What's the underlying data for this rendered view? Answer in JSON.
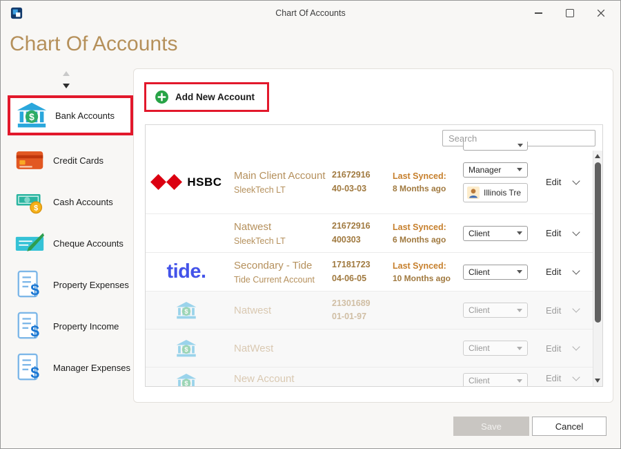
{
  "titlebar": {
    "title": "Chart Of Accounts"
  },
  "page": {
    "heading": "Chart Of Accounts"
  },
  "sidebar": {
    "items": [
      {
        "label": "Bank Accounts"
      },
      {
        "label": "Credit Cards"
      },
      {
        "label": "Cash Accounts"
      },
      {
        "label": "Cheque Accounts"
      },
      {
        "label": "Property Expenses"
      },
      {
        "label": "Property Income"
      },
      {
        "label": "Manager Expenses"
      }
    ]
  },
  "toolbar": {
    "add_account_label": "Add New Account"
  },
  "search": {
    "placeholder": "Search"
  },
  "table": {
    "rows": [
      {
        "brand": "HSBC",
        "name": "Main Client Account",
        "subtitle": "SleekTech LT",
        "account_number": "21672916",
        "sort_code": "40-03-03",
        "last_synced_label": "Last Synced:",
        "last_synced": "8 Months ago",
        "role": "Manager",
        "assignee": "Illinois Tre",
        "edit_label": "Edit"
      },
      {
        "name": "Natwest",
        "subtitle": "SleekTech LT",
        "account_number": "21672916",
        "sort_code": "400303",
        "last_synced_label": "Last Synced:",
        "last_synced": "6 Months ago",
        "role": "Client",
        "edit_label": "Edit"
      },
      {
        "brand": "tide.",
        "name": "Secondary - Tide",
        "subtitle": "Tide Current Account",
        "account_number": "17181723",
        "sort_code": "04-06-05",
        "last_synced_label": "Last Synced:",
        "last_synced": "10 Months ago",
        "role": "Client",
        "edit_label": "Edit"
      },
      {
        "name": "Natwest",
        "account_number": "21301689",
        "sort_code": "01-01-97",
        "role": "Client",
        "edit_label": "Edit",
        "disabled": true
      },
      {
        "name": "NatWest",
        "role": "Client",
        "edit_label": "Edit",
        "disabled": true
      },
      {
        "name": "New Account",
        "role": "Client",
        "edit_label": "Edit",
        "disabled": true
      }
    ]
  },
  "footer": {
    "save_label": "Save",
    "cancel_label": "Cancel"
  },
  "colors": {
    "heading_gold": "#b5905a",
    "annotation_red": "#e2182b",
    "hsbc_red": "#db0011",
    "tide_blue": "#4353e9",
    "synced_orange": "#c67f2c"
  }
}
